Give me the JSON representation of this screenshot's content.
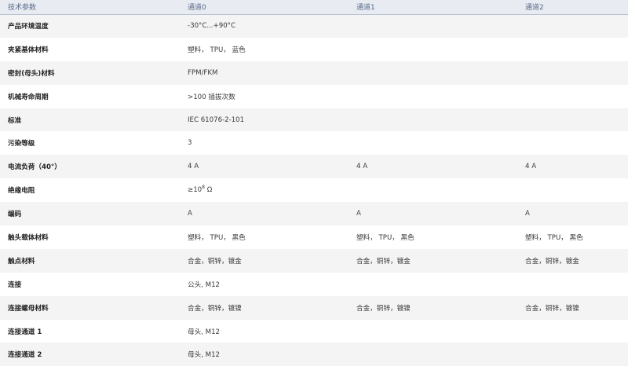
{
  "header": {
    "param": "技术参数",
    "ch0": "通道0",
    "ch1": "通道1",
    "ch2": "通道2"
  },
  "rows": [
    {
      "param": "产品环境温度",
      "ch0": "-30°C...+90°C",
      "ch1": "",
      "ch2": ""
    },
    {
      "param": "夹紧基体材料",
      "ch0": "塑料， TPU， 蓝色",
      "ch1": "",
      "ch2": ""
    },
    {
      "param": "密封(母头)材料",
      "ch0": "FPM/FKM",
      "ch1": "",
      "ch2": ""
    },
    {
      "param": "机械寿命周期",
      "ch0": ">100 插拔次数",
      "ch1": "",
      "ch2": ""
    },
    {
      "param": "标准",
      "ch0": "IEC 61076-2-101",
      "ch1": "",
      "ch2": ""
    },
    {
      "param": "污染等级",
      "ch0": "3",
      "ch1": "",
      "ch2": ""
    },
    {
      "param": "电流负荷（40°）",
      "ch0": "4 A",
      "ch1": "4 A",
      "ch2": "4 A"
    },
    {
      "param": "绝缘电阻",
      "ch0_base": "≥10",
      "ch0_sup": "8",
      "ch0_unit": " Ω",
      "ch1": "",
      "ch2": ""
    },
    {
      "param": "编码",
      "ch0": "A",
      "ch1": "A",
      "ch2": "A"
    },
    {
      "param": "触头载体材料",
      "ch0": "塑料， TPU， 黑色",
      "ch1": "塑料， TPU， 黑色",
      "ch2": "塑料， TPU， 黑色"
    },
    {
      "param": "触点材料",
      "ch0": "合金，铜锌，镀金",
      "ch1": "合金，铜锌，镀金",
      "ch2": "合金，铜锌，镀金"
    },
    {
      "param": "连接",
      "ch0": "公头, M12",
      "ch1": "",
      "ch2": ""
    },
    {
      "param": "连接螺母材料",
      "ch0": "合金，铜锌，镀镍",
      "ch1": "合金，铜锌，镀镍",
      "ch2": "合金，铜锌，镀镍"
    },
    {
      "param": "连接通道 1",
      "ch0": "母头, M12",
      "ch1": "",
      "ch2": ""
    },
    {
      "param": "连接通道 2",
      "ch0": "母头, M12",
      "ch1": "",
      "ch2": ""
    }
  ]
}
